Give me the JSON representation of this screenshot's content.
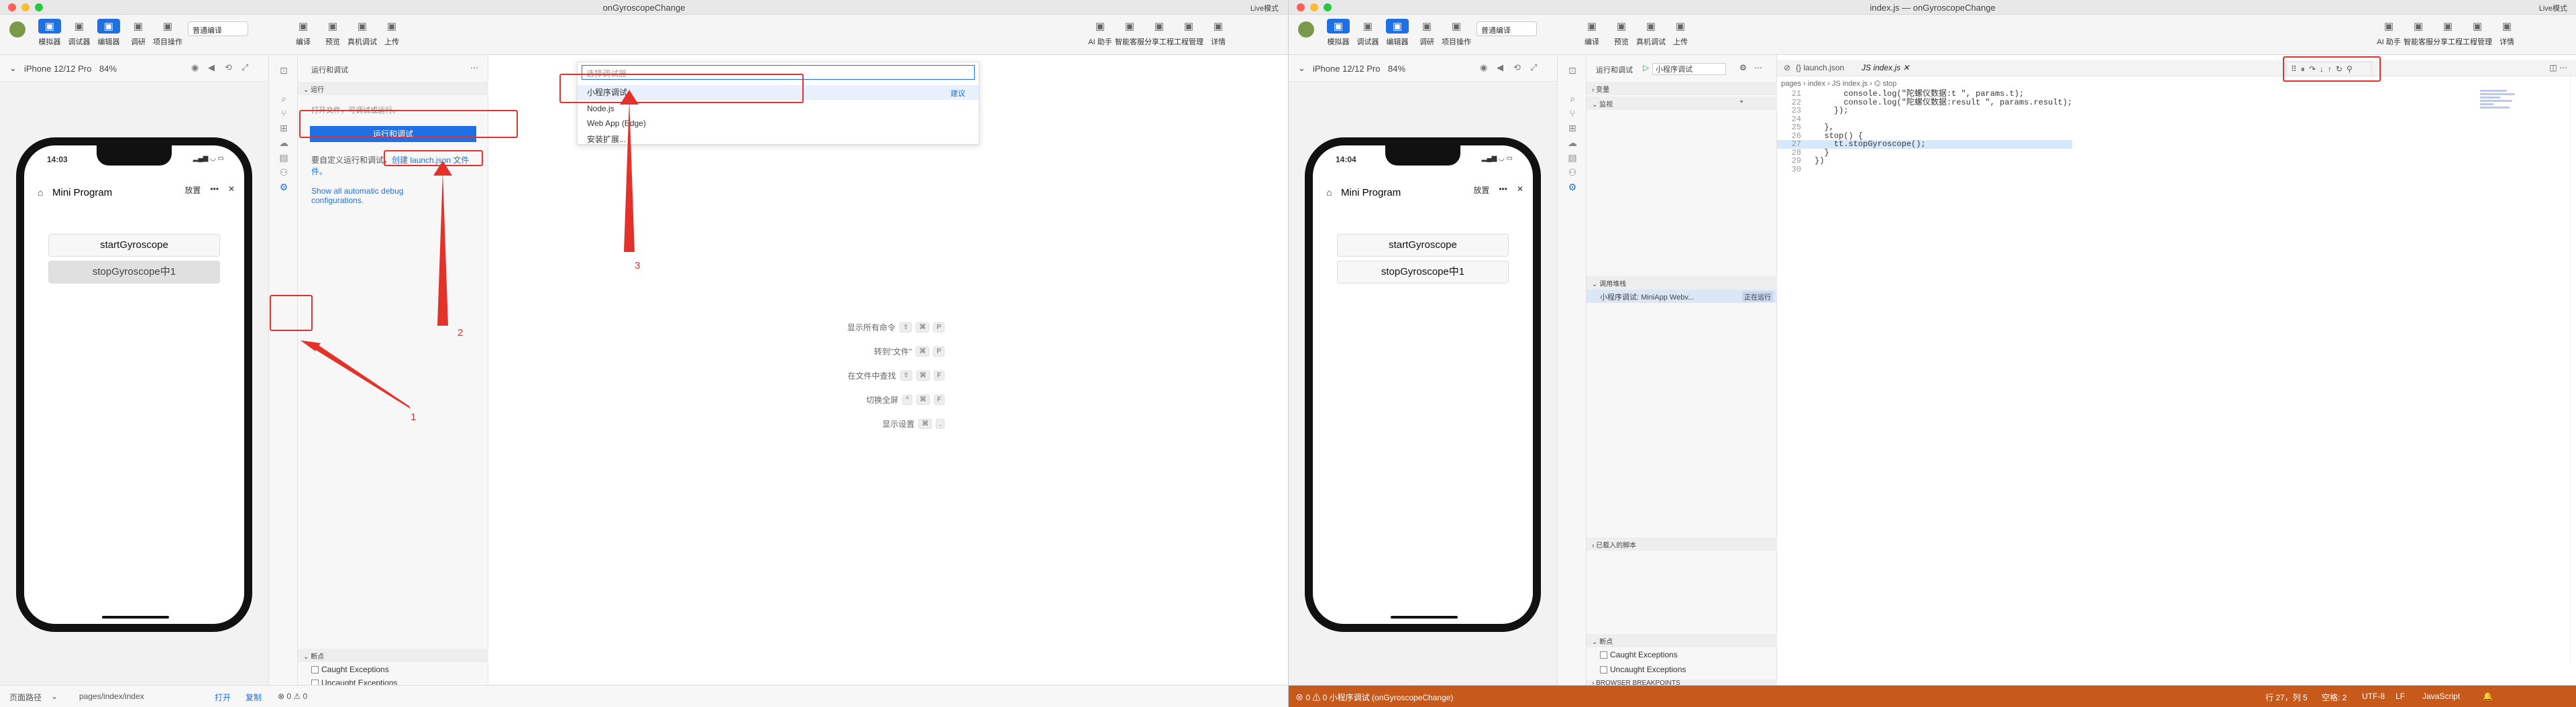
{
  "colors": {
    "accent": "#1f6fe5",
    "annotation": "#e4322b",
    "debug_status": "#c75a1a"
  },
  "left": {
    "title": "onGyroscopeChange",
    "live": "Live模式",
    "toolbar": {
      "left": [
        {
          "label": "模拟器",
          "icon": "phone-icon",
          "active": true
        },
        {
          "label": "调试器",
          "icon": "debug-icon"
        },
        {
          "label": "编辑器",
          "icon": "code-icon",
          "active": true
        },
        {
          "label": "调研",
          "icon": "diamond-icon"
        },
        {
          "label": "项目操作",
          "icon": "folder-icon"
        }
      ],
      "mode": "普通编译",
      "mid": [
        {
          "label": "编译",
          "icon": "refresh-icon"
        },
        {
          "label": "预览",
          "icon": "eye-icon"
        },
        {
          "label": "真机调试",
          "icon": "cpu-icon"
        },
        {
          "label": "上传",
          "icon": "cloud-upload-icon"
        }
      ],
      "right": [
        {
          "label": "AI 助手",
          "icon": "sparkle-icon"
        },
        {
          "label": "智能客服",
          "icon": "headset-icon"
        },
        {
          "label": "分享工程",
          "icon": "share-icon"
        },
        {
          "label": "工程管理",
          "icon": "briefcase-icon"
        },
        {
          "label": "详情",
          "icon": "menu-icon"
        }
      ]
    },
    "sim": {
      "device": "iPhone 12/12 Pro",
      "zoom": "84%",
      "time": "14:03",
      "nav_title": "Mini Program",
      "nav_action": "放置",
      "btn1": "startGyroscope",
      "btn2": "stopGyroscope中1"
    },
    "panel": {
      "title": "运行和调试",
      "section_run": "运行",
      "open_file_text": "打开文件，可调试或运行。",
      "run_button": "运行和调试",
      "custom_text": "要自定义运行和调试，",
      "custom_link": "创建 launch.json 文件",
      "custom_link2": "件。",
      "show_all": "Show all automatic debug configurations.",
      "breakpoints": "断点",
      "caught": "Caught Exceptions",
      "uncaught": "Uncaught Exceptions"
    },
    "quickpick": {
      "placeholder": "选择调试器",
      "items": [
        "小程序调试",
        "Node.js",
        "Web App (Edge)",
        "安装扩展..."
      ],
      "suggest": "建议"
    },
    "hints": [
      {
        "label": "显示所有命令",
        "keys": [
          "⇧",
          "⌘",
          "P"
        ]
      },
      {
        "label": "转到\"文件\"",
        "keys": [
          "⌘",
          "P"
        ]
      },
      {
        "label": "在文件中查找",
        "keys": [
          "⇧",
          "⌘",
          "F"
        ]
      },
      {
        "label": "切换全屏",
        "keys": [
          "^",
          "⌘",
          "F"
        ]
      },
      {
        "label": "显示设置",
        "keys": [
          "⌘",
          ","
        ]
      }
    ],
    "annotations": [
      "1",
      "2",
      "3"
    ],
    "status": {
      "path_label": "页面路径",
      "path": "pages/index/index",
      "open": "打开",
      "copy": "复制",
      "errors": "⊗ 0 ⚠ 0"
    }
  },
  "right": {
    "title": "index.js — onGyroscopeChange",
    "sim": {
      "time": "14:04"
    },
    "panel": {
      "title": "运行和调试",
      "config": "小程序调试",
      "variables": "变量",
      "watch": "监视",
      "callstack": "调用堆栈",
      "callstack_item": "小程序调试: MiniApp Webv...",
      "callstack_status": "正在运行",
      "loaded": "已载入的脚本",
      "breakpoints": "断点",
      "browser_bp": "BROWSER BREAKPOINTS"
    },
    "tabs": [
      "launch.json",
      "index.js"
    ],
    "breadcrumb": "pages › index › JS index.js › ⌬ stop",
    "code": [
      {
        "n": "21",
        "t": "      console.log(\"陀螺仪数据:t \", params.t);"
      },
      {
        "n": "22",
        "t": "      console.log(\"陀螺仪数据:result \", params.result);"
      },
      {
        "n": "23",
        "t": "    });"
      },
      {
        "n": "24",
        "t": ""
      },
      {
        "n": "25",
        "t": "  },"
      },
      {
        "n": "26",
        "t": "  stop() {"
      },
      {
        "n": "27",
        "t": "    tt.stopGyroscope();"
      },
      {
        "n": "28",
        "t": "  }"
      },
      {
        "n": "29",
        "t": "})"
      },
      {
        "n": "30",
        "t": ""
      }
    ],
    "debug_controls": [
      "⠿",
      "⏸",
      "↷",
      "↓",
      "↑",
      "↻",
      "⚲"
    ],
    "status": {
      "debug": "⊗ 0 ⚠ 0  小程序调试 (onGyroscopeChange)",
      "pos": "行 27，列 5",
      "spaces": "空格: 2",
      "enc": "UTF-8",
      "eol": "LF",
      "lang": "JavaScript"
    }
  }
}
